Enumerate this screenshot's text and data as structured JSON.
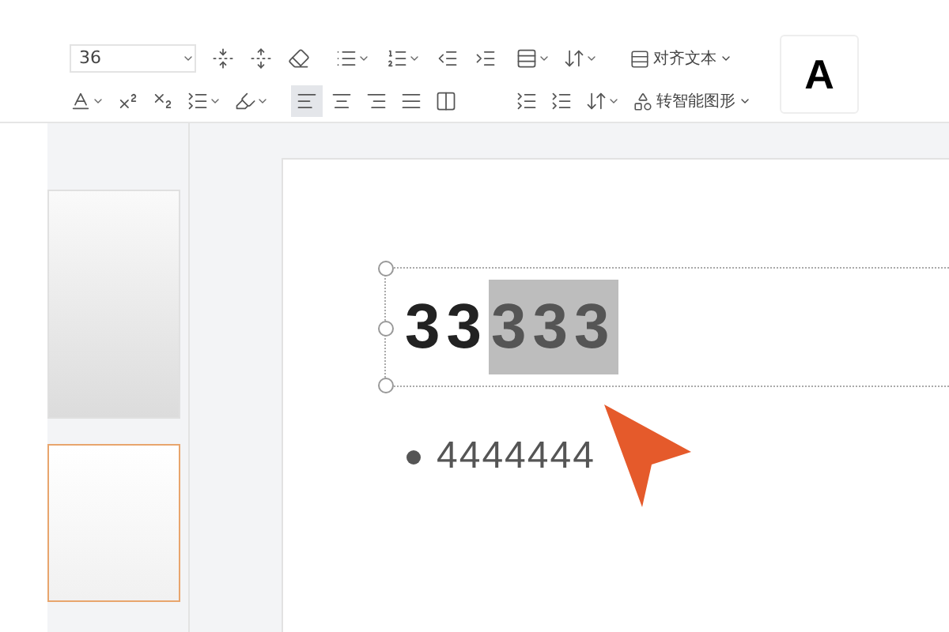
{
  "toolbar": {
    "font_size": "36",
    "align_text": "对齐文本",
    "smart_art": "转智能图形",
    "style_preview": "A",
    "paragraph_align": [
      {
        "kind": "left",
        "selected": true
      },
      {
        "kind": "center",
        "selected": false
      },
      {
        "kind": "right",
        "selected": false
      },
      {
        "kind": "justify",
        "selected": false
      },
      {
        "kind": "distributed",
        "selected": false
      }
    ]
  },
  "slides": [
    {
      "selected": false
    },
    {
      "selected": true
    }
  ],
  "title": {
    "text": "33",
    "selected_text": "333"
  },
  "bullets": [
    "4444444"
  ]
}
